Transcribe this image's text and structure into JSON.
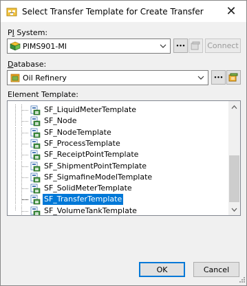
{
  "window": {
    "title": "Select Transfer Template for Create Transfer",
    "close_glyph": "✕"
  },
  "pi_system": {
    "label_prefix": "P",
    "label_underlined": "I",
    "label_suffix": " System:",
    "value": "PIMS901-MI",
    "icon": "pi-server-icon",
    "browse_label": "•••",
    "connect_label": "Connect"
  },
  "database": {
    "label_prefix": "",
    "label_underlined": "D",
    "label_suffix": "atabase:",
    "value": "Oil Refinery",
    "icon": "database-icon",
    "browse_label": "•••"
  },
  "element_template": {
    "label": "Element Template:",
    "items": [
      {
        "label": "SF_LiquidMeterTemplate"
      },
      {
        "label": "SF_Node"
      },
      {
        "label": "SF_NodeTemplate"
      },
      {
        "label": "SF_ProcessTemplate"
      },
      {
        "label": "SF_ReceiptPointTemplate"
      },
      {
        "label": "SF_ShipmentPointTemplate"
      },
      {
        "label": "SF_SigmafineModelTemplate"
      },
      {
        "label": "SF_SolidMeterTemplate"
      },
      {
        "label": "SF_TransferTemplate",
        "selected": true
      },
      {
        "label": "SF_VolumeTankTemplate"
      }
    ]
  },
  "buttons": {
    "ok": "OK",
    "cancel": "Cancel"
  },
  "colors": {
    "selection": "#0078d7",
    "dialog_bg": "#f0f0f0"
  }
}
